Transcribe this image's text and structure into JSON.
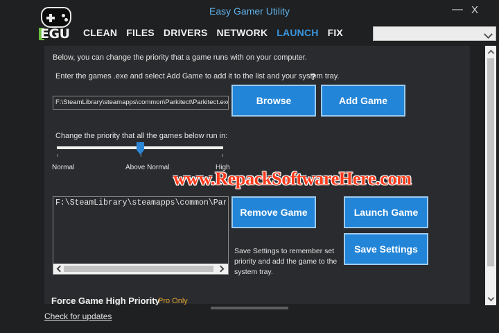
{
  "window": {
    "title": "Easy Gamer Utility",
    "minimize_glyph": "—",
    "close_glyph": "X"
  },
  "logo": {
    "text": "EGU",
    "icon": "gamepad-icon"
  },
  "nav": {
    "tabs": [
      {
        "label": "CLEAN",
        "active": false
      },
      {
        "label": "FILES",
        "active": false
      },
      {
        "label": "DRIVERS",
        "active": false
      },
      {
        "label": "NETWORK",
        "active": false
      },
      {
        "label": "LAUNCH",
        "active": true
      },
      {
        "label": "FIX",
        "active": false
      }
    ]
  },
  "top_combo": {
    "value": ""
  },
  "launch": {
    "intro_text": "Below, you can change the priority that a game runs with on your computer.",
    "instruction_text": "Enter the games .exe and select Add Game to add it to the list and your system tray.",
    "help_glyph": "?",
    "path_value": "F:\\SteamLibrary\\steamapps\\common\\Parkitect\\Parkitect.exe",
    "browse_label": "Browse",
    "add_game_label": "Add Game",
    "priority_label": "Change the priority that all the games below run in:",
    "slider": {
      "labels": [
        "Normal",
        "Above Normal",
        "High"
      ],
      "selected_index": 1
    },
    "games_list": [
      "F:\\SteamLibrary\\steamapps\\common\\Parkitect\\Parkitect.exe"
    ],
    "remove_game_label": "Remove Game",
    "launch_game_label": "Launch Game",
    "save_settings_label": "Save Settings",
    "save_hint": "Save Settings to remember set priority and add the game to the system tray.",
    "force_title": "Force Game High Priority",
    "pro_badge": "Pro Only"
  },
  "footer": {
    "check_updates_label": "Check for updates"
  },
  "watermark": {
    "text": "www.RepackSoftwareHere.com"
  },
  "colors": {
    "accent": "#2385d8",
    "active_tab": "#3a96dd",
    "title": "#5fb0e8",
    "watermark": "#ff3a1a",
    "pro_badge": "#e0a030"
  }
}
